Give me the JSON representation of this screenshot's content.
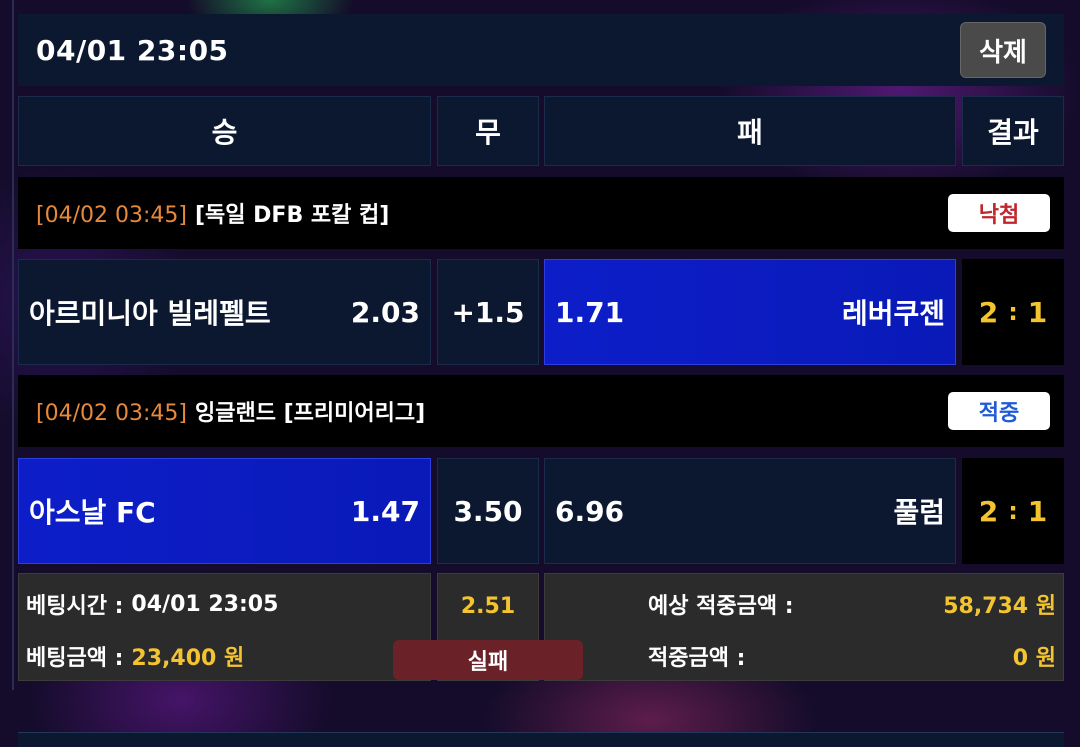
{
  "header": {
    "datetime": "04/01 23:05",
    "delete_label": "삭제"
  },
  "columns": {
    "win": "승",
    "draw": "무",
    "lose": "패",
    "result": "결과"
  },
  "matches": [
    {
      "time": "[04/02 03:45]",
      "league": "[독일 DFB 포칼 컵]",
      "result_label": "낙첨",
      "result_color": "#c0272d",
      "home_team": "아르미니아 빌레펠트",
      "home_odds": "2.03",
      "middle": "+1.5",
      "away_odds": "1.71",
      "away_team": "레버쿠젠",
      "selected": "away",
      "score_home": "2",
      "score_sep": ":",
      "score_away": "1"
    },
    {
      "time": "[04/02 03:45]",
      "league": "잉글랜드 [프리미어리그]",
      "result_label": "적중",
      "result_color": "#1f5bd6",
      "home_team": "아스날 FC",
      "home_odds": "1.47",
      "middle": "3.50",
      "away_odds": "6.96",
      "away_team": "풀럼",
      "selected": "home",
      "score_home": "2",
      "score_sep": ":",
      "score_away": "1"
    }
  ],
  "footer": {
    "bet_time_label": "베팅시간 :",
    "bet_time_value": "04/01 23:05",
    "bet_amount_label": "베팅금액 :",
    "bet_amount_value": "23,400 원",
    "total_odds": "2.51",
    "status_label": "실패",
    "expected_win_label": "예상 적중금액 :",
    "expected_win_value": "58,734 원",
    "win_amount_label": "적중금액 :",
    "win_amount_value": "0 원"
  },
  "colors": {
    "accent_yellow": "#f4c430",
    "selected_blue": "#0d1ec9",
    "time_orange": "#e7893b"
  }
}
